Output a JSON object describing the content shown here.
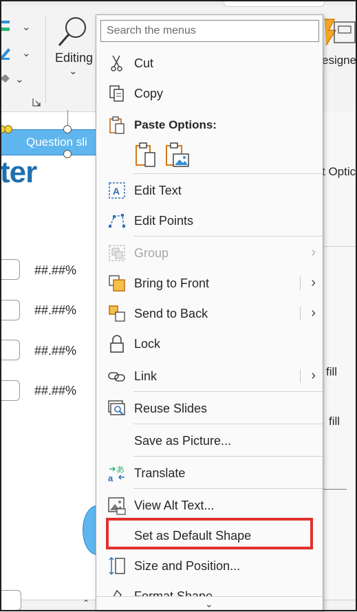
{
  "ribbon": {
    "editing_label": "Editing",
    "designer_label": "esigner"
  },
  "slide": {
    "question_text": "Question sli",
    "big_text": "ter",
    "percent_rows": [
      "##.##%",
      "##.##%",
      "##.##%",
      "##.##%"
    ],
    "right_pane": {
      "options_text": "t Optic",
      "fill_1": "fill",
      "fill_2": "fill"
    }
  },
  "menu": {
    "search_placeholder": "Search the menus",
    "items": [
      {
        "label": "Cut",
        "icon": "scissors-icon"
      },
      {
        "label": "Copy",
        "icon": "copy-icon"
      },
      {
        "label": "Paste Options:",
        "icon": "paste-icon"
      },
      {
        "label": "Edit Text",
        "icon": "edit-text-icon"
      },
      {
        "label": "Edit Points",
        "icon": "edit-points-icon"
      },
      {
        "label": "Group",
        "icon": "group-icon",
        "disabled": true
      },
      {
        "label": "Bring to Front",
        "icon": "bring-to-front-icon"
      },
      {
        "label": "Send to Back",
        "icon": "send-to-back-icon"
      },
      {
        "label": "Lock",
        "icon": "lock-icon"
      },
      {
        "label": "Link",
        "icon": "link-icon"
      },
      {
        "label": "Reuse Slides",
        "icon": "reuse-slides-icon"
      },
      {
        "label": "Save as Picture...",
        "icon": ""
      },
      {
        "label": "Translate",
        "icon": "translate-icon"
      },
      {
        "label": "View Alt Text...",
        "icon": "alt-text-icon"
      },
      {
        "label": "Set as Default Shape",
        "icon": ""
      },
      {
        "label": "Size and Position...",
        "icon": "size-position-icon"
      },
      {
        "label": "Format Shape...",
        "icon": "format-shape-icon"
      }
    ],
    "paste_options": [
      "paste-keep-formatting-icon",
      "paste-as-picture-icon"
    ]
  },
  "colors": {
    "accent_highlight": "#e0312d",
    "question_box": "#5fb6ef",
    "big_text": "#1f6fb0"
  }
}
